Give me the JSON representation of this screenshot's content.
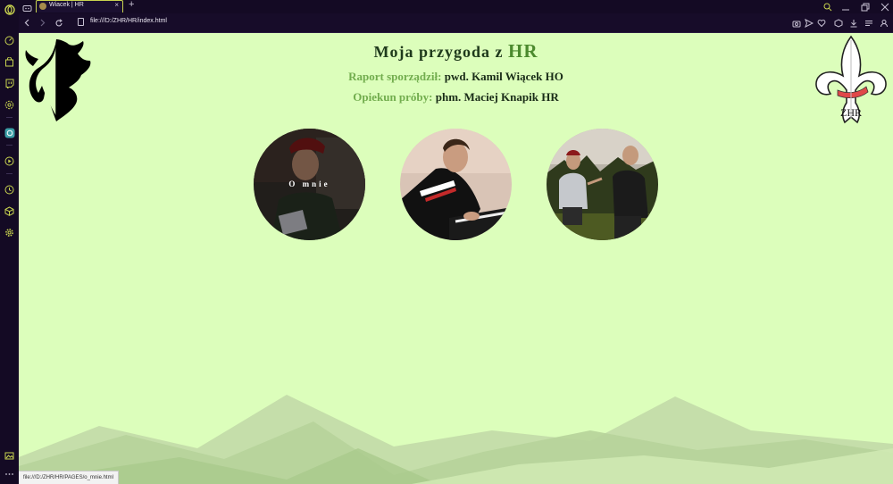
{
  "browser": {
    "tab_title": "Wiacek | HR",
    "tab_close": "×",
    "new_tab": "+",
    "url": "file:///D:/ZHR/HR/index.html",
    "status_url": "file:///D:/ZHR/HR/PAGES/o_mnie.html",
    "accent_color": "#c9d44f",
    "sidebar_icons": [
      "speed-dial-icon",
      "shopping-icon",
      "twitch-icon",
      "chatgpt-icon",
      "ai-assistant-icon",
      "player-icon",
      "history-icon",
      "extensions-icon",
      "settings-icon",
      "snapshot-icon",
      "more-icon"
    ],
    "toolbar_icons": [
      "camera-icon",
      "send-icon",
      "heart-icon",
      "cube-icon",
      "download-icon",
      "easy-setup-icon",
      "profile-icon"
    ]
  },
  "page": {
    "background": "#dcfebb",
    "title_prefix": "Moja przygoda z",
    "title_accent": "HR",
    "reporter_label": "Raport sporządził:",
    "reporter_value": "pwd. Kamil Wiącek HO",
    "guardian_label": "Opiekun próby:",
    "guardian_value": "phm. Maciej Knapik HR",
    "photos": [
      {
        "label": "O mnie",
        "image": "scout-in-beret-reading-photo"
      },
      {
        "label": "",
        "image": "boy-playing-piano-photo"
      },
      {
        "label": "",
        "image": "two-scouts-outdoors-photo"
      }
    ],
    "right_logo_text": "ZHR"
  }
}
